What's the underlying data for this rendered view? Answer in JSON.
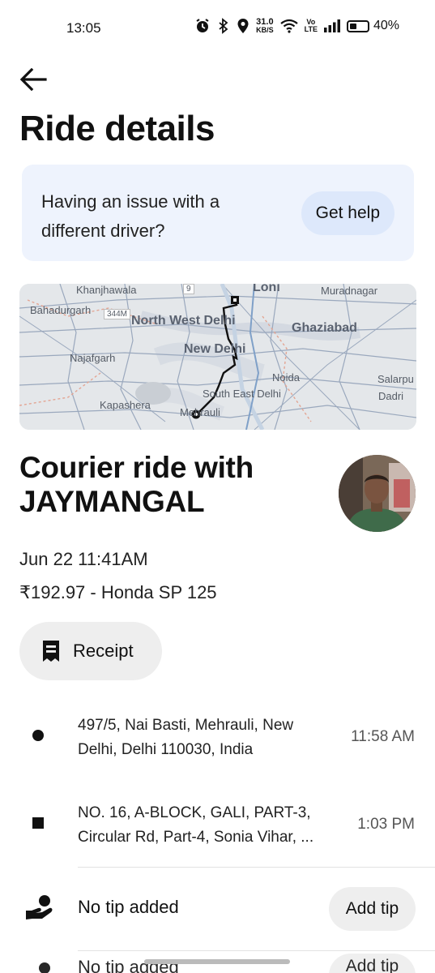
{
  "status_bar": {
    "time": "13:05",
    "net_speed_value": "31.0",
    "net_speed_unit": "KB/S",
    "volte_top": "Vo",
    "volte_bottom": "LTE",
    "battery": "40%",
    "battery_level": 0.4,
    "icons": [
      "alarm-icon",
      "bluetooth-icon",
      "location-icon",
      "wifi-icon",
      "signal-icon",
      "battery-icon"
    ]
  },
  "header": {
    "back_icon": "arrow-left-icon",
    "title": "Ride details"
  },
  "help_card": {
    "text": "Having an issue with a different driver?",
    "button_label": "Get help"
  },
  "map": {
    "labels": {
      "khanjhawala": "Khanjhawala",
      "road_9": "9",
      "loni": "Loni",
      "muradnagar": "Muradnagar",
      "bahadurgarh": "Bahadurgarh",
      "road_344m": "344M",
      "north_west_delhi": "North West Delhi",
      "ghaziabad": "Ghaziabad",
      "najafgarh": "Najafgarh",
      "new_delhi": "New Delhi",
      "noida": "Noida",
      "salarpu": "Salarpu",
      "south_east_delhi": "South East Delhi",
      "dadri": "Dadri",
      "kapashera": "Kapashera",
      "mehrauli": "Mehrauli"
    },
    "route_color": "#111111"
  },
  "ride": {
    "title": "Courier ride with JAYMANGAL",
    "date": "Jun 22 11:41AM",
    "fare": "₹192.97 - Honda SP 125",
    "avatar_icon": "driver-avatar"
  },
  "receipt": {
    "icon": "receipt-icon",
    "label": "Receipt"
  },
  "stops": [
    {
      "marker": "circle",
      "address": "497/5, Nai Basti, Mehrauli, New Delhi, Delhi 110030, India",
      "time": "11:58 AM"
    },
    {
      "marker": "square",
      "address": "NO. 16, A-BLOCK, GALI, PART-3, Circular Rd, Part-4, Sonia Vihar, ...",
      "time": "1:03 PM"
    }
  ],
  "tip": {
    "icon": "hand-coin-icon",
    "text": "No tip added",
    "button_label": "Add tip"
  },
  "ghost_row": {
    "text": "No tip added",
    "button_label": "Add tip"
  }
}
